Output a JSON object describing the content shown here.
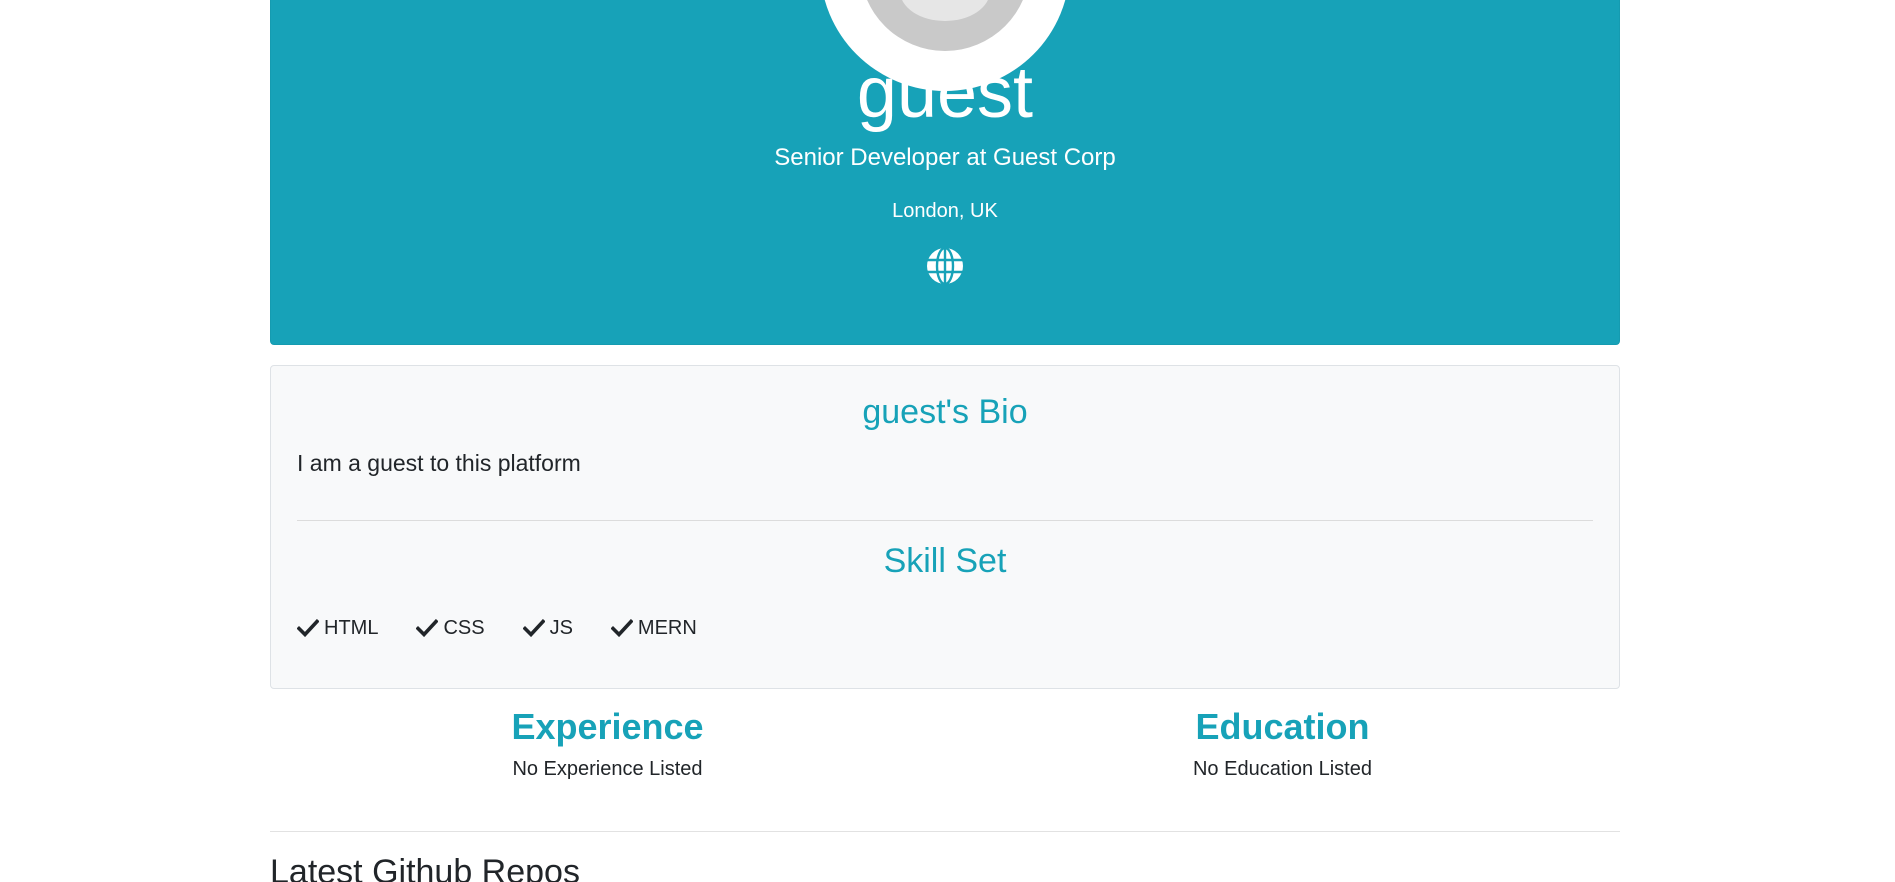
{
  "profile": {
    "name": "guest",
    "status": "Senior Developer at Guest Corp",
    "location": "London, UK",
    "website_icon": "globe-icon",
    "accent_color": "#17a2b8"
  },
  "about": {
    "bio_title": "guest's Bio",
    "bio": "I am a guest to this platform",
    "skills_title": "Skill Set",
    "skills": [
      "HTML",
      "CSS",
      "JS",
      "MERN"
    ]
  },
  "experience": {
    "title": "Experience",
    "empty": "No Experience Listed"
  },
  "education": {
    "title": "Education",
    "empty": "No Education Listed"
  },
  "github": {
    "title": "Latest Github Repos"
  }
}
